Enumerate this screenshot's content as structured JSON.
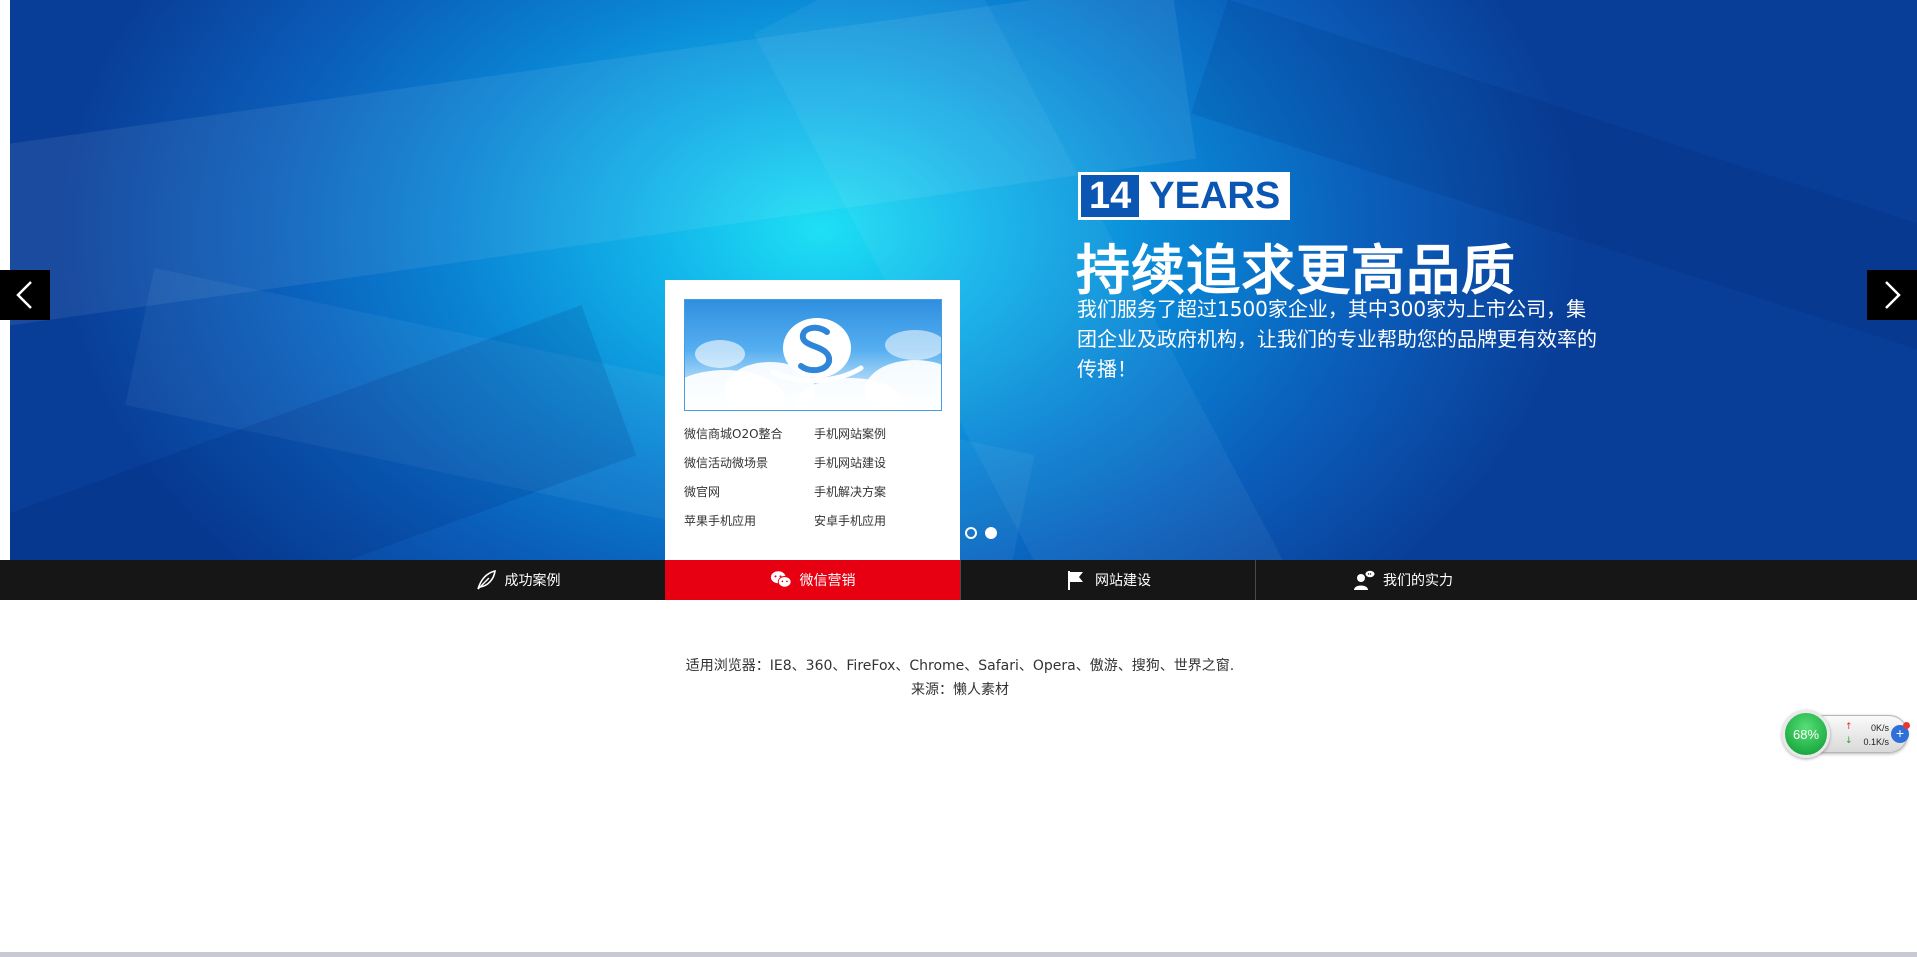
{
  "banner": {
    "years_number": "14",
    "years_word": "YEARS",
    "headline": "持续追求更高品质",
    "subtext": "我们服务了超过1500家企业，其中300家为上市公司，集团企业及政府机构，让我们的专业帮助您的品牌更有效率的传播！",
    "slide_count": 2,
    "active_slide": 2
  },
  "dropdown": {
    "links": [
      "微信商城O2O整合",
      "手机网站案例",
      "微信活动微场景",
      "手机网站建设",
      "微官网",
      "手机解决方案",
      "苹果手机应用",
      "安卓手机应用"
    ]
  },
  "nav": {
    "items": [
      {
        "label": "成功案例",
        "icon": "leaf-icon"
      },
      {
        "label": "微信营销",
        "icon": "wechat-icon"
      },
      {
        "label": "网站建设",
        "icon": "flag-icon"
      },
      {
        "label": "我们的实力",
        "icon": "user-chat-icon"
      }
    ],
    "active_index": 1
  },
  "footer": {
    "browsers": "适用浏览器：IE8、360、FireFox、Chrome、Safari、Opera、傲游、搜狗、世界之窗.",
    "source": "来源：懒人素材"
  },
  "speed_widget": {
    "percent": "68%",
    "upload": "0K/s",
    "download": "0.1K/s",
    "plus": "+"
  },
  "colors": {
    "nav_bg": "#161616",
    "nav_active": "#e60012",
    "banner_center": "#1ee0f4",
    "banner_edge": "#093e98",
    "badge_blue": "#0b55b3"
  }
}
